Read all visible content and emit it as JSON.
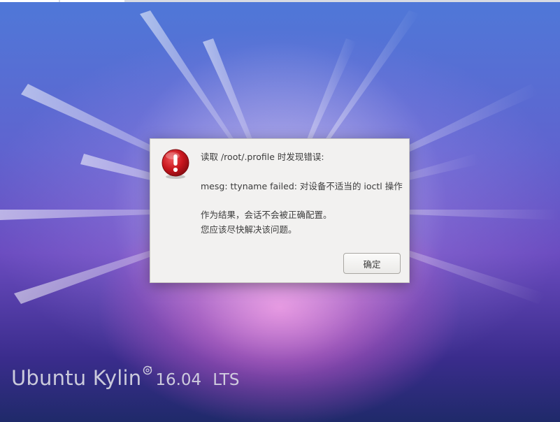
{
  "dialog": {
    "icon": "error-icon",
    "line1": "读取 /root/.profile 时发现错误:",
    "line2": "mesg: ttyname failed: 对设备不适当的 ioctl 操作",
    "line3": "作为结果，会话不会被正确配置。",
    "line4": "您应该尽快解决该问题。",
    "ok_label": "确定"
  },
  "branding": {
    "name": "Ubuntu Kylin",
    "version": "16.04",
    "edition": "LTS",
    "mark_icon": "ubuntu-kylin-logo-icon"
  },
  "colors": {
    "error_red": "#c8161d",
    "dialog_bg": "#f2f1f0",
    "text": "#3c3c3c"
  }
}
